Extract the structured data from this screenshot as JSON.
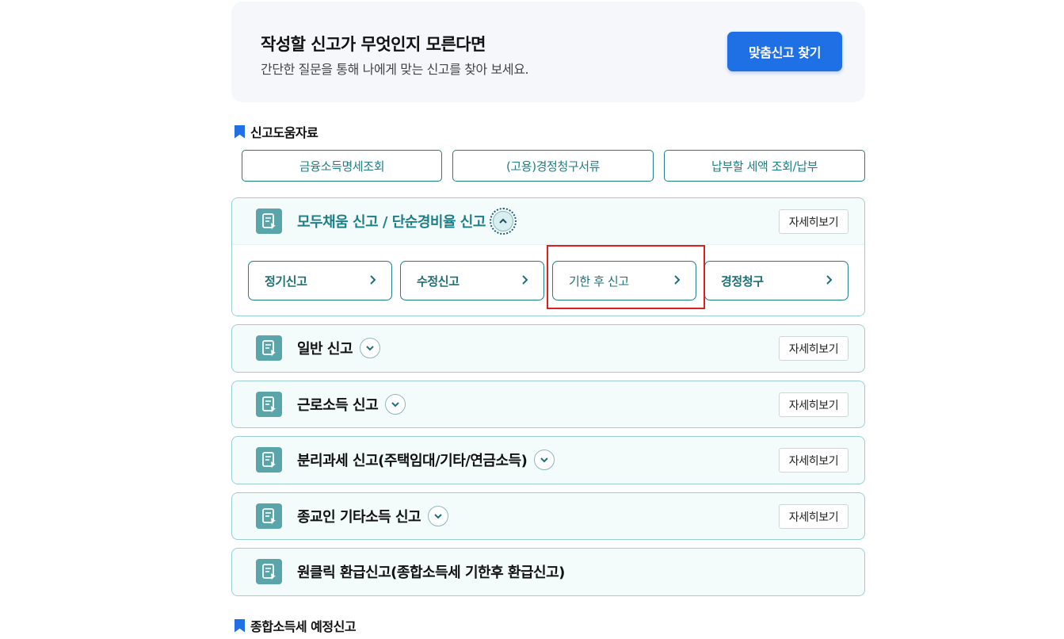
{
  "finder": {
    "title": "작성할 신고가 무엇인지 모른다면",
    "subtitle": "간단한 질문을 통해 나에게 맞는 신고를 찾아 보세요.",
    "button": "맞춤신고 찾기"
  },
  "help_section": {
    "title": "신고도움자료",
    "buttons": [
      "금융소득명세조회",
      "(고용)경정청구서류",
      "납부할 세액 조회/납부"
    ]
  },
  "colors": {
    "primary_blue": "#1f6fe5",
    "teal": "#1d7f86",
    "highlight_red": "#e01e1e"
  },
  "cards": [
    {
      "title": "모두채움 신고 / 단순경비율 신고",
      "detail": "자세히보기",
      "expanded": true,
      "items": [
        "정기신고",
        "수정신고",
        "기한 후 신고",
        "경정청구"
      ]
    },
    {
      "title": "일반 신고",
      "detail": "자세히보기"
    },
    {
      "title": "근로소득 신고",
      "detail": "자세히보기"
    },
    {
      "title": "분리과세 신고(주택임대/기타/연금소득)",
      "detail": "자세히보기"
    },
    {
      "title": "종교인 기타소득 신고",
      "detail": "자세히보기"
    },
    {
      "title": "원클릭 환급신고(종합소득세 기한후 환급신고)"
    }
  ],
  "next_section": {
    "title": "종합소득세 예정신고"
  }
}
